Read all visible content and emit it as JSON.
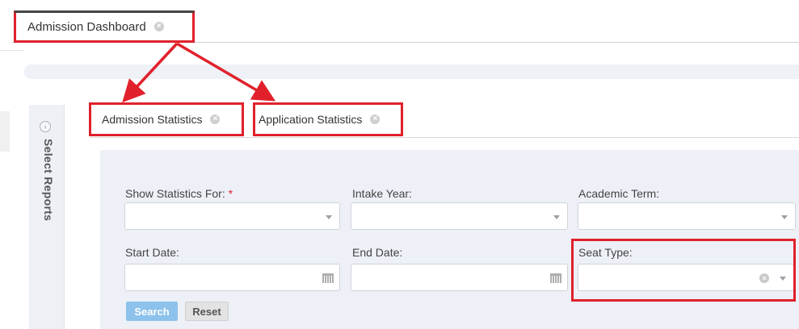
{
  "dashboard_tab": {
    "label": "Admission Dashboard",
    "close_icon": "close-circle-icon"
  },
  "side_panel": {
    "label": "Select Reports",
    "icon": "chevron-right-icon"
  },
  "sub_tabs": [
    {
      "label": "Admission Statistics",
      "close_icon": "close-circle-icon"
    },
    {
      "label": "Application Statistics",
      "close_icon": "close-circle-icon"
    }
  ],
  "form": {
    "show_statistics_for": {
      "label": "Show Statistics For:",
      "required_mark": "*",
      "value": ""
    },
    "intake_year": {
      "label": "Intake Year:",
      "value": ""
    },
    "academic_term": {
      "label": "Academic Term:",
      "value": ""
    },
    "start_date": {
      "label": "Start Date:",
      "value": ""
    },
    "end_date": {
      "label": "End Date:",
      "value": ""
    },
    "seat_type": {
      "label": "Seat Type:",
      "value": ""
    }
  },
  "buttons": {
    "search": "Search",
    "reset": "Reset"
  },
  "colors": {
    "highlight": "#e0212b",
    "search_button": "#8cc2ec",
    "panel_bg": "#edf0f6"
  }
}
